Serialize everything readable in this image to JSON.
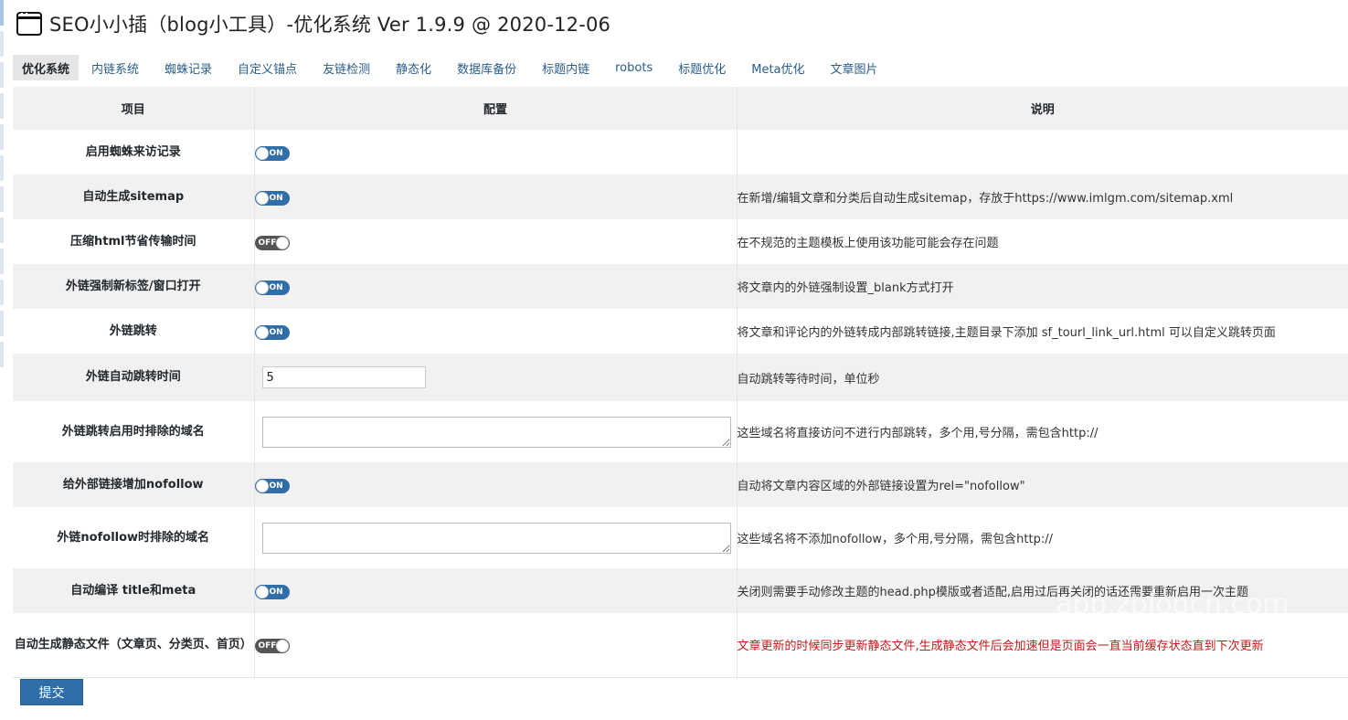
{
  "header": {
    "title": "SEO小小插（blog小工具）-优化系统 Ver 1.9.9 @ 2020-12-06",
    "icon": "window-icon"
  },
  "tabs": [
    {
      "label": "优化系统",
      "active": true
    },
    {
      "label": "内链系统"
    },
    {
      "label": "蜘蛛记录"
    },
    {
      "label": "自定义锚点"
    },
    {
      "label": "友链检测"
    },
    {
      "label": "静态化"
    },
    {
      "label": "数据库备份"
    },
    {
      "label": "标题内链"
    },
    {
      "label": "robots"
    },
    {
      "label": "标题优化"
    },
    {
      "label": "Meta优化"
    },
    {
      "label": "文章图片"
    }
  ],
  "table": {
    "headers": {
      "item": "项目",
      "config": "配置",
      "desc": "说明"
    },
    "rows": [
      {
        "label": "启用蜘蛛来访记录",
        "toggle": "ON",
        "desc": ""
      },
      {
        "label": "自动生成sitemap",
        "toggle": "ON",
        "desc": "在新增/编辑文章和分类后自动生成sitemap，存放于https://www.imlgm.com/sitemap.xml"
      },
      {
        "label": "压缩html节省传输时间",
        "toggle": "OFF",
        "desc": "在不规范的主题模板上使用该功能可能会存在问题"
      },
      {
        "label": "外链强制新标签/窗口打开",
        "toggle": "ON",
        "desc": "将文章内的外链强制设置_blank方式打开"
      },
      {
        "label": "外链跳转",
        "toggle": "ON",
        "desc": "将文章和评论内的外链转成内部跳转链接,主题目录下添加 sf_tourl_link_url.html 可以自定义跳转页面"
      },
      {
        "label": "外链自动跳转时间",
        "input_value": "5",
        "desc": "自动跳转等待时间，单位秒"
      },
      {
        "label": "外链跳转启用时排除的域名",
        "textarea": true,
        "desc": "这些域名将直接访问不进行内部跳转，多个用,号分隔，需包含http://"
      },
      {
        "label": "给外部链接增加nofollow",
        "toggle": "ON",
        "desc": "自动将文章内容区域的外部链接设置为rel=\"nofollow\""
      },
      {
        "label": "外链nofollow时排除的域名",
        "textarea": true,
        "desc": "这些域名将不添加nofollow，多个用,号分隔，需包含http://"
      },
      {
        "label": "自动编译 title和meta",
        "toggle": "ON",
        "desc": "关闭则需要手动修改主题的head.php模版或者适配,启用过后再关闭的话还需要重新启用一次主题"
      },
      {
        "label": "自动生成静态文件（文章页、分类页、首页）",
        "toggle": "OFF",
        "desc": "文章更新的时候同步更新静态文件,生成静态文件后会加速但是页面会一直当前缓存状态直到下次更新",
        "desc_color": "#c41a1a"
      }
    ]
  },
  "submit_label": "提交",
  "watermark": "app.zblogcn.com"
}
